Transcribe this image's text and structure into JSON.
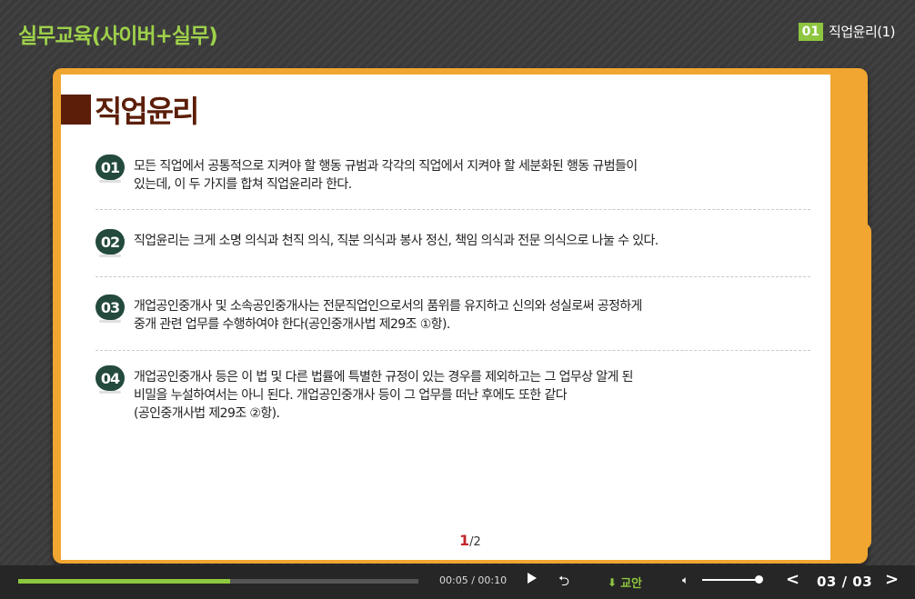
{
  "header": {
    "course_title": "실무교육(사이버+실무)",
    "chapter_num": "01",
    "chapter_title": "직업윤리(1)"
  },
  "slide": {
    "heading": "직업윤리",
    "items": [
      {
        "num": "01",
        "text": "모든 직업에서 공통적으로 지켜야 할 행동 규범과 각각의 직업에서 지켜야 할 세분화된 행동 규범들이\n있는데, 이 두 가지를 합쳐 직업윤리라 한다."
      },
      {
        "num": "02",
        "text": "직업윤리는 크게 소명 의식과 천직 의식, 직분 의식과 봉사 정신, 책임 의식과 전문 의식으로 나눌 수 있다."
      },
      {
        "num": "03",
        "text": "개업공인중개사 및 소속공인중개사는 전문직업인으로서의 품위를 유지하고 신의와 성실로써 공정하게\n중개 관련 업무를 수행하여야 한다(공인중개사법 제29조 ①항)."
      },
      {
        "num": "04",
        "text": "개업공인중개사 등은 이 법 및 다른 법률에 특별한 규정이 있는 경우를 제외하고는 그 업무상 알게 된\n비밀을 누설하여서는 아니 된다. 개업공인중개사 등이 그 업무를 떠난 후에도 또한 같다\n(공인중개사법 제29조 ②항)."
      }
    ],
    "page_current": "1",
    "page_total": "/2"
  },
  "player": {
    "progress": 0.53,
    "time": "00:05 / 00:10",
    "download_label": "교안",
    "volume": 0.95,
    "page_indicator": "03 / 03"
  },
  "icons": {
    "play": "play-icon",
    "replay": "replay-icon",
    "download": "download-icon",
    "volume": "volume-icon",
    "prev": "chevron-left-icon",
    "next": "chevron-right-icon"
  },
  "colors": {
    "accent": "#8dc63f",
    "heading": "#5c1e08",
    "badge": "#234a3c",
    "folder": "#f0a630",
    "page_current": "#c1272d"
  }
}
